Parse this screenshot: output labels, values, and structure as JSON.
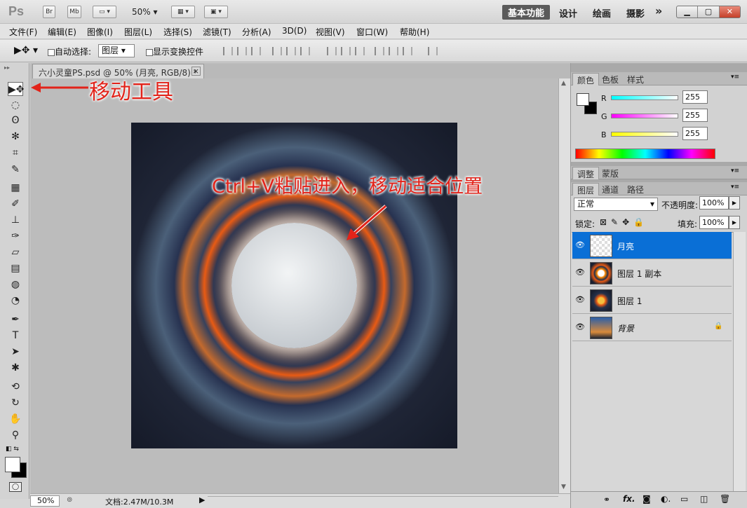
{
  "app": {
    "logo": "Ps",
    "title_buttons": [
      "Br",
      "Mb"
    ],
    "zoom": "50%",
    "workspaces": [
      "基本功能",
      "设计",
      "绘画",
      "摄影"
    ],
    "more": "»"
  },
  "menu": [
    "文件(F)",
    "编辑(E)",
    "图像(I)",
    "图层(L)",
    "选择(S)",
    "滤镜(T)",
    "分析(A)",
    "3D(D)",
    "视图(V)",
    "窗口(W)",
    "帮助(H)"
  ],
  "options": {
    "auto_select_label": "自动选择:",
    "auto_select_value": "图层",
    "show_transform_label": "显示变换控件"
  },
  "document": {
    "tab_title": "六小灵童PS.psd @ 50% (月亮, RGB/8) *",
    "close": "×"
  },
  "annotations": {
    "move_tool": "移动工具",
    "paste": "Ctrl+V粘贴进入，移动适合位置"
  },
  "status": {
    "zoom": "50%",
    "doc_info": "文档:2.47M/10.3M"
  },
  "color_panel": {
    "tabs": [
      "颜色",
      "色板",
      "样式"
    ],
    "channels": [
      {
        "label": "R",
        "value": "255"
      },
      {
        "label": "G",
        "value": "255"
      },
      {
        "label": "B",
        "value": "255"
      }
    ]
  },
  "adjust_panel": {
    "tabs": [
      "调整",
      "蒙版"
    ]
  },
  "layers_panel": {
    "tabs": [
      "图层",
      "通道",
      "路径"
    ],
    "blend_mode": "正常",
    "opacity_label": "不透明度:",
    "opacity": "100%",
    "lock_label": "锁定:",
    "fill_label": "填充:",
    "fill": "100%",
    "layers": [
      {
        "name": "月亮",
        "selected": true
      },
      {
        "name": "图层 1 副本",
        "selected": false
      },
      {
        "name": "图层 1",
        "selected": false
      },
      {
        "name": "背景",
        "selected": false,
        "locked": true
      }
    ]
  },
  "colors": {
    "selected_layer": "#0a6fd6",
    "annotation": "#e2231a"
  }
}
